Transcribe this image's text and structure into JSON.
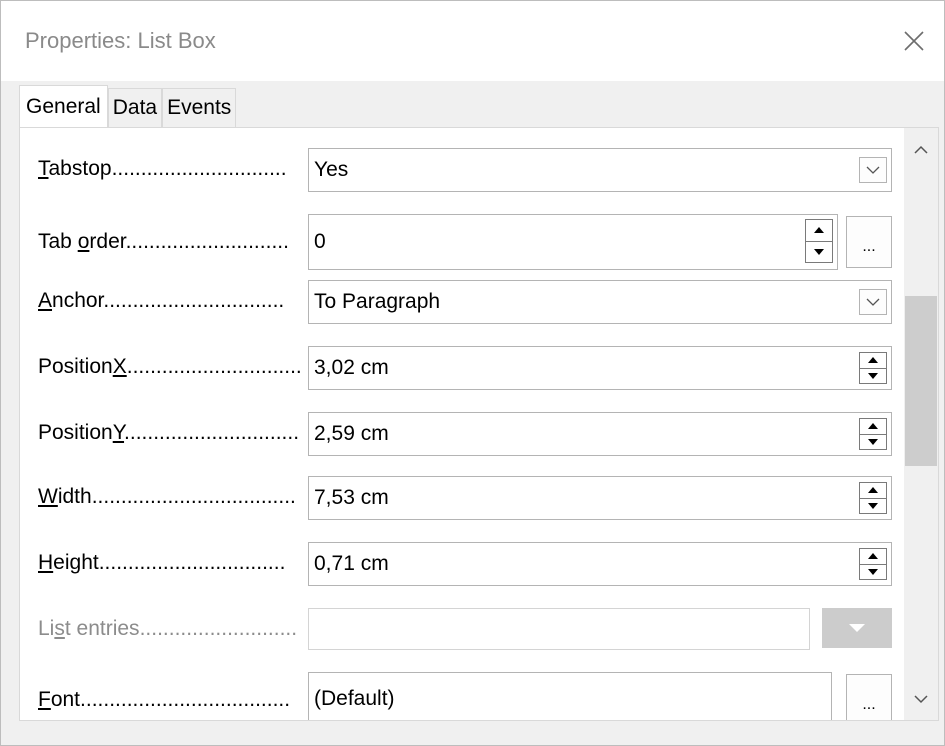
{
  "window": {
    "title": "Properties: List Box"
  },
  "tabs": [
    {
      "label": "General",
      "active": true
    },
    {
      "label": "Data",
      "active": false
    },
    {
      "label": "Events",
      "active": false
    }
  ],
  "rows": {
    "tabstop": {
      "pre": "",
      "key": "T",
      "post": "abstop",
      "dots": "..............................",
      "value": "Yes"
    },
    "tab_order": {
      "pre": "Tab ",
      "key": "o",
      "post": "rder",
      "dots": "............................",
      "value": "0",
      "ellipsis": "..."
    },
    "anchor": {
      "pre": "",
      "key": "A",
      "post": "nchor",
      "dots": "...............................",
      "value": "To Paragraph"
    },
    "position_x": {
      "pre": "Position",
      "key": "X",
      "post": "",
      "dots": "..............................",
      "value": "3,02 cm"
    },
    "position_y": {
      "pre": "Position",
      "key": "Y",
      "post": "",
      "dots": "..............................",
      "value": "2,59 cm"
    },
    "width": {
      "pre": "",
      "key": "W",
      "post": "idth",
      "dots": "...................................",
      "value": "7,53 cm"
    },
    "height": {
      "pre": "",
      "key": "H",
      "post": "eight",
      "dots": "................................",
      "value": "0,71 cm"
    },
    "list_entries": {
      "pre": "Li",
      "key": "s",
      "post": "t entries",
      "dots": "...........................",
      "value": ""
    },
    "font": {
      "pre": "",
      "key": "F",
      "post": "ont",
      "dots": "....................................",
      "value": "(Default)",
      "ellipsis": "..."
    }
  },
  "icons": {
    "close": "close-icon",
    "dropdown": "chevron-down-icon",
    "spin_up": "triangle-up-icon",
    "spin_down": "triangle-down-icon",
    "scroll_up": "chevron-up-icon",
    "scroll_down": "chevron-down-icon"
  }
}
